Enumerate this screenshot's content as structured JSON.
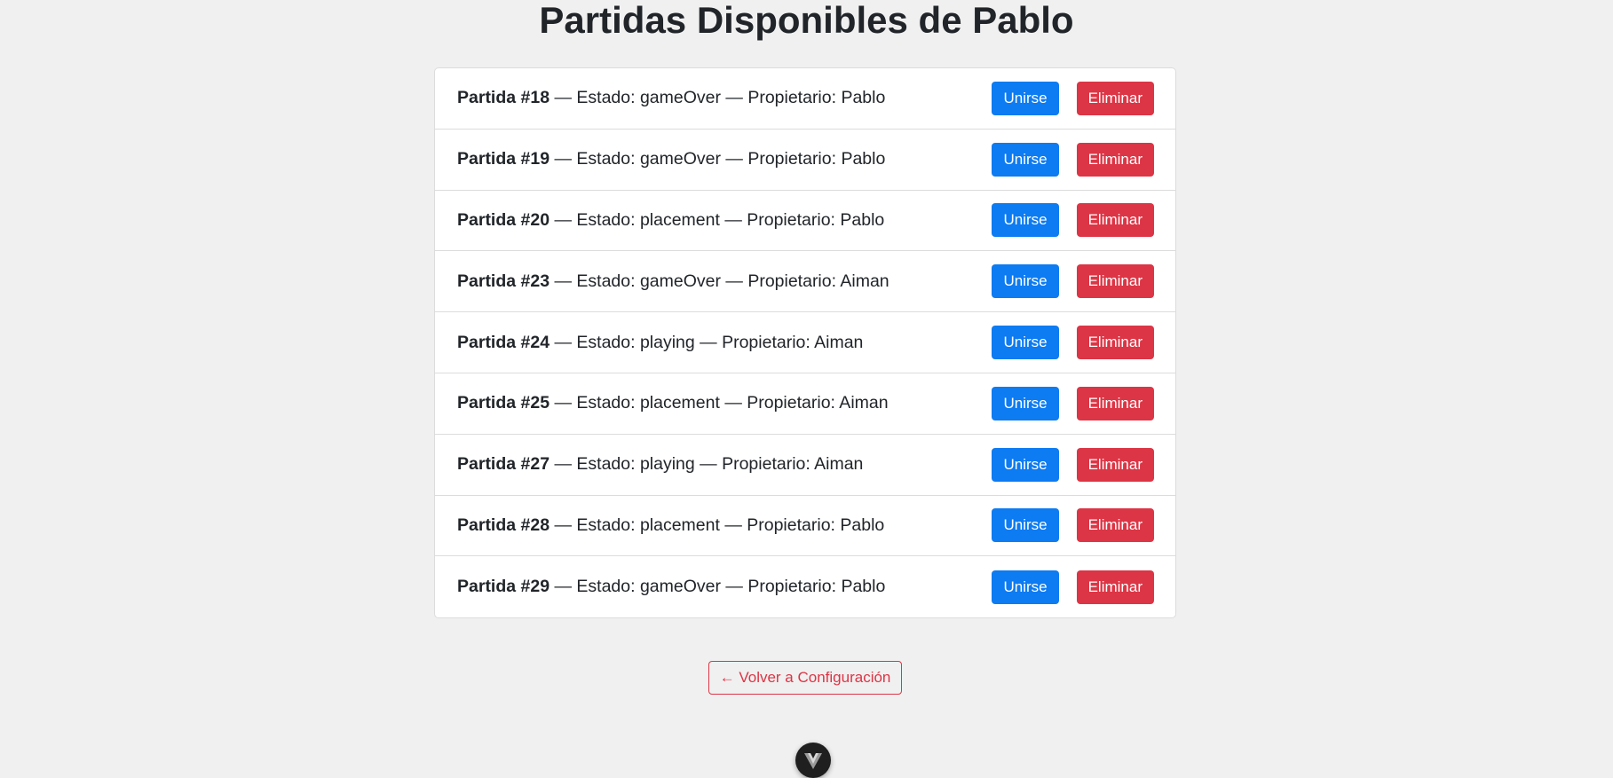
{
  "page": {
    "title": "Partidas Disponibles de Pablo"
  },
  "games": [
    {
      "label": "Partida #18",
      "details": " — Estado: gameOver — Propietario: Pablo"
    },
    {
      "label": "Partida #19",
      "details": " — Estado: gameOver — Propietario: Pablo"
    },
    {
      "label": "Partida #20",
      "details": " — Estado: placement — Propietario: Pablo"
    },
    {
      "label": "Partida #23",
      "details": " — Estado: gameOver — Propietario: Aiman"
    },
    {
      "label": "Partida #24",
      "details": " — Estado: playing — Propietario: Aiman"
    },
    {
      "label": "Partida #25",
      "details": " — Estado: placement — Propietario: Aiman"
    },
    {
      "label": "Partida #27",
      "details": " — Estado: playing — Propietario: Aiman"
    },
    {
      "label": "Partida #28",
      "details": " — Estado: placement — Propietario: Pablo"
    },
    {
      "label": "Partida #29",
      "details": " — Estado: gameOver — Propietario: Pablo"
    }
  ],
  "actions": {
    "join_label": "Unirse",
    "delete_label": "Eliminar"
  },
  "footer": {
    "back_label": "← Volver a Configuración",
    "fab_icon": "vue-logo-icon"
  },
  "colors": {
    "join": "#0d7bf2",
    "delete": "#dc3545",
    "background": "#f0f0f0"
  }
}
